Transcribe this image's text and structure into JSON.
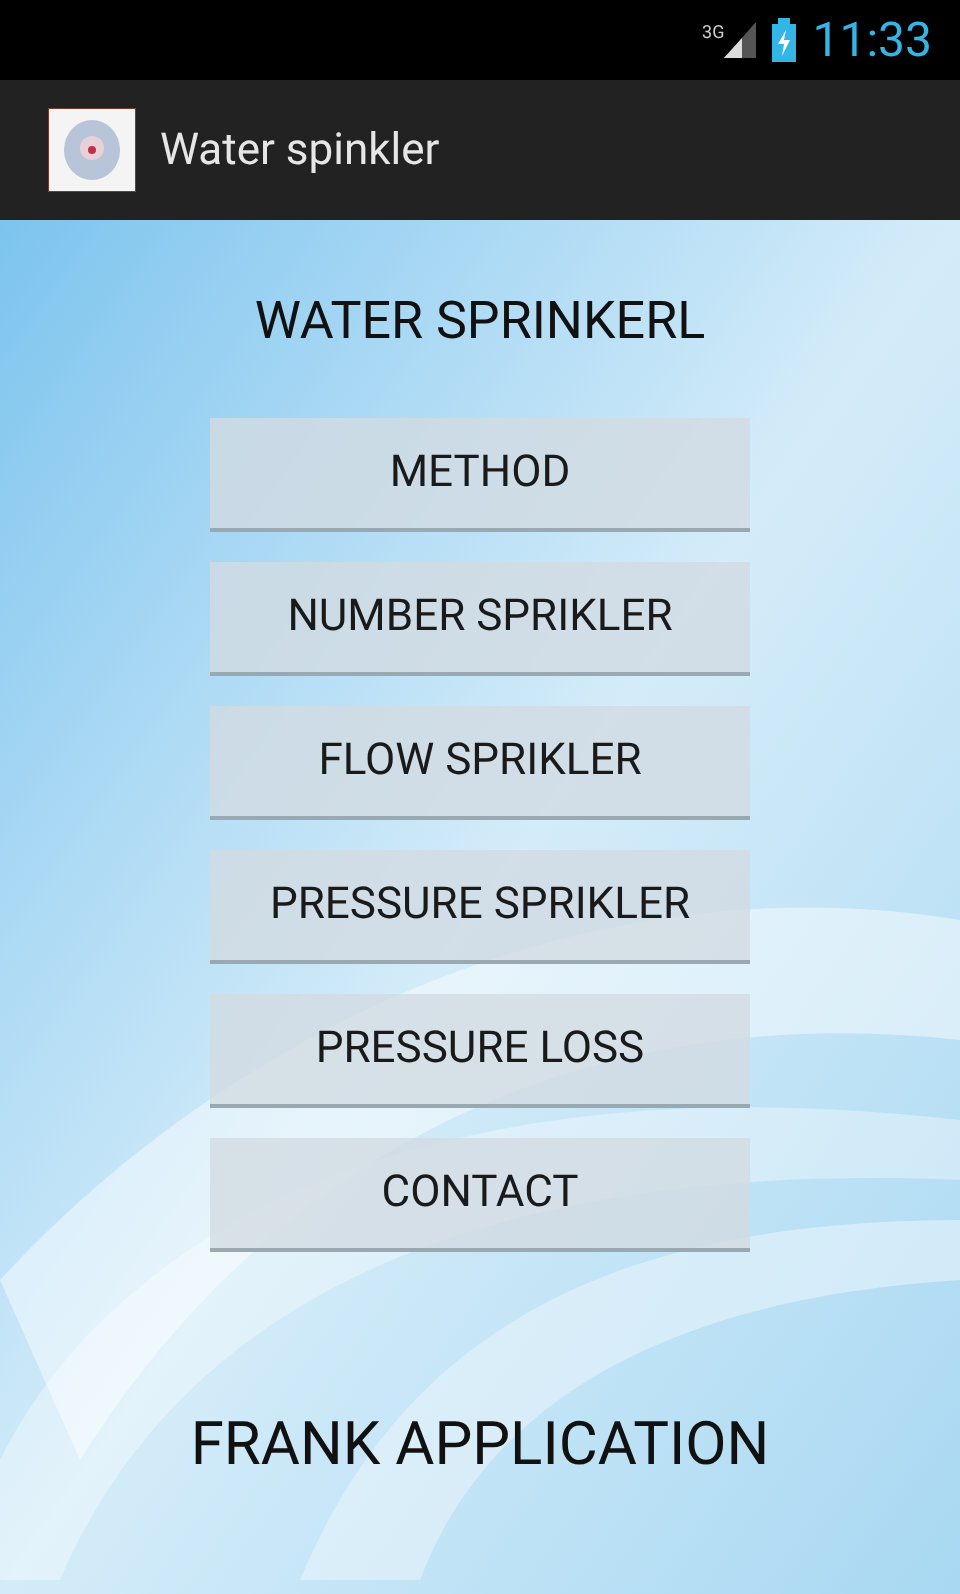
{
  "status_bar": {
    "network": "3G",
    "time": "11:33"
  },
  "action_bar": {
    "title": "Water spinkler"
  },
  "heading": "WATER SPRINKERL",
  "buttons": [
    "METHOD",
    "NUMBER SPRIKLER",
    "FLOW SPRIKLER",
    "PRESSURE SPRIKLER",
    "PRESSURE LOSS",
    "CONTACT"
  ],
  "footer": "FRANK APPLICATION"
}
